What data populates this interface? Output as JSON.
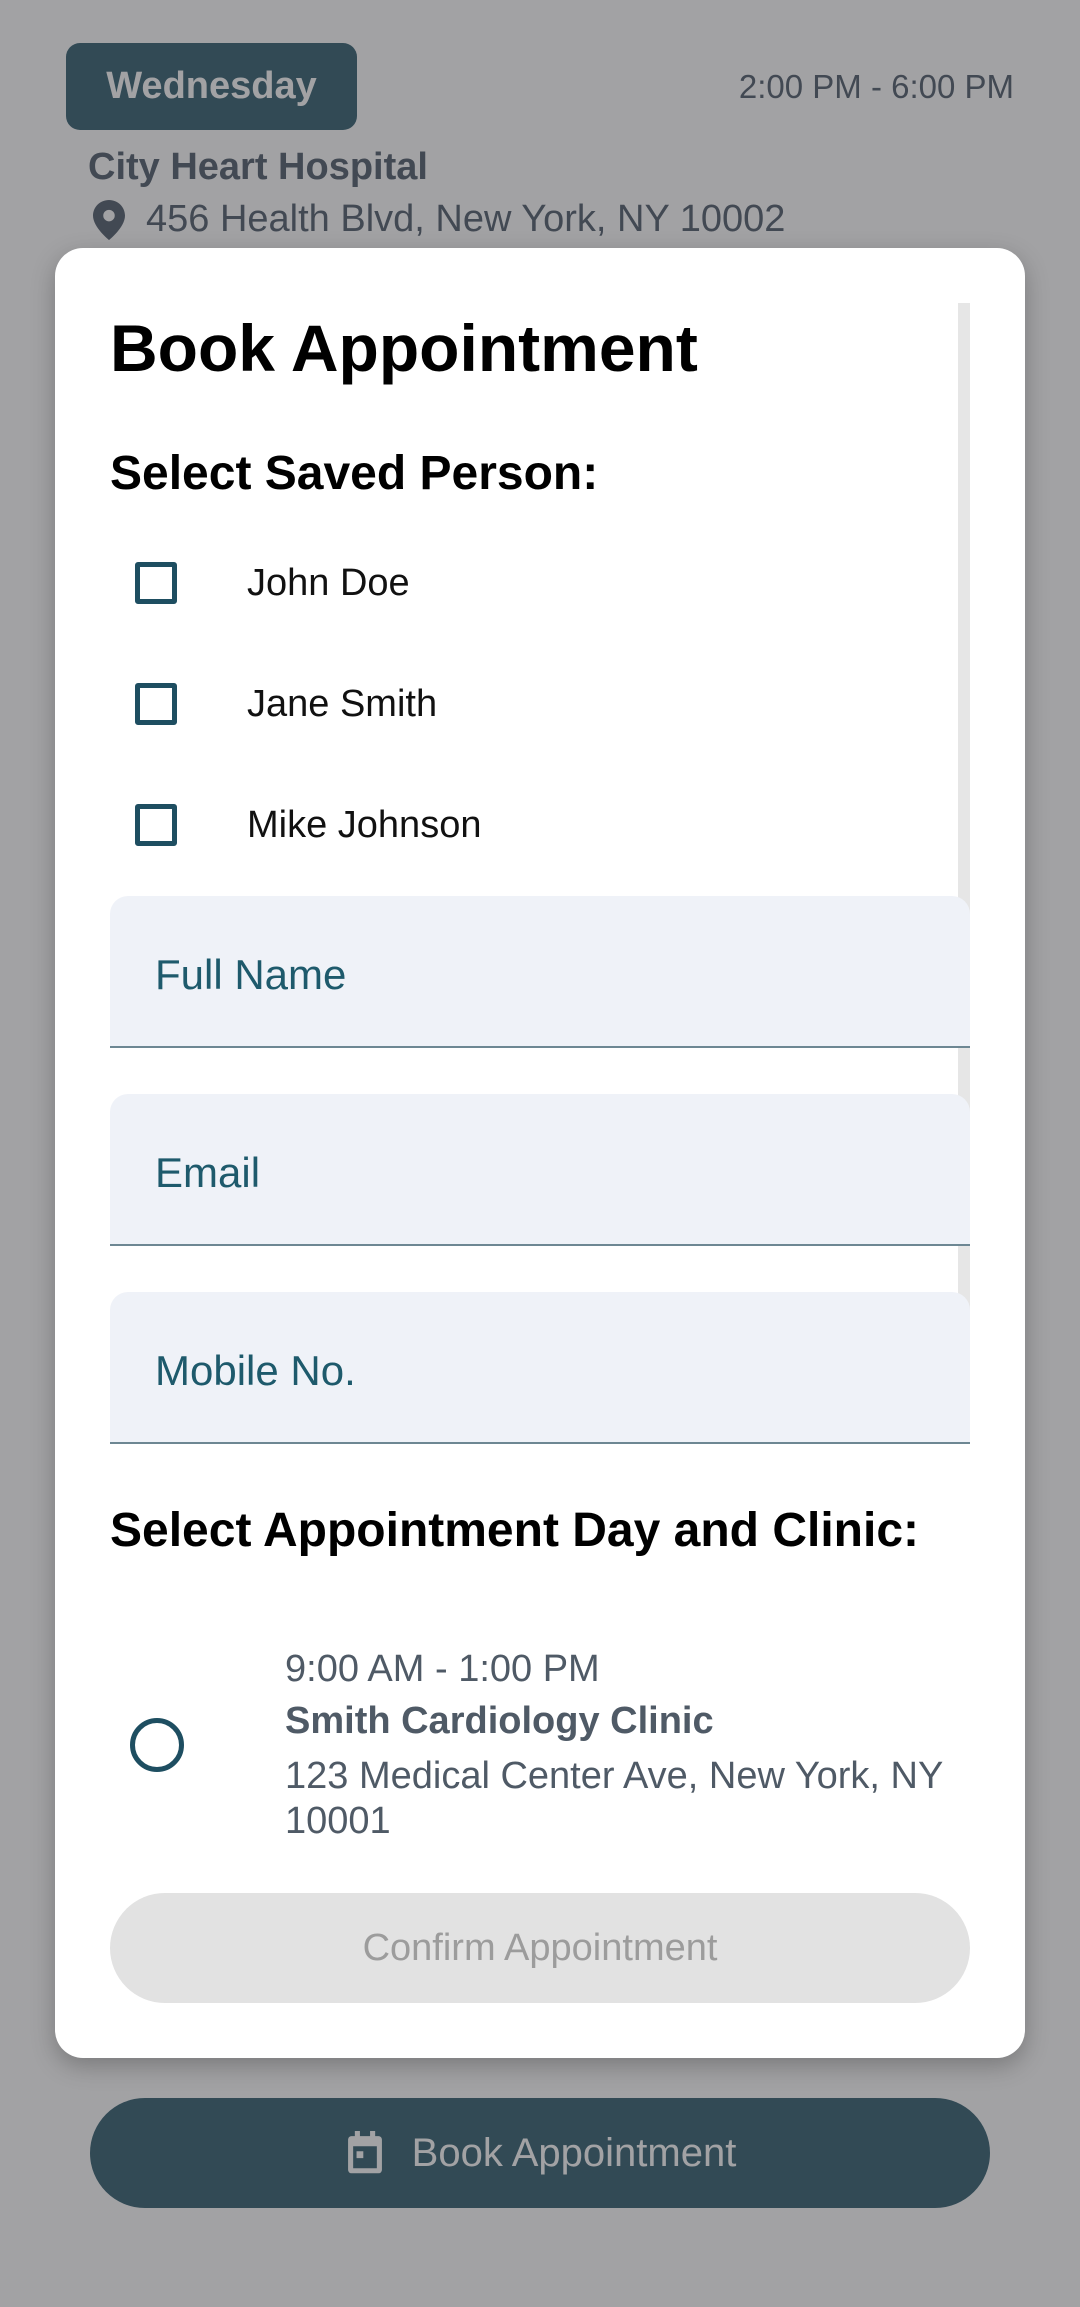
{
  "background": {
    "day_chip": "Wednesday",
    "time_range": "2:00 PM - 6:00 PM",
    "hospital_name": "City Heart Hospital",
    "hospital_address": "456 Health Blvd, New York, NY 10002",
    "book_button_label": "Book Appointment",
    "accent_color": "#1e4e61"
  },
  "dialog": {
    "title": "Book Appointment",
    "saved_person_label": "Select Saved Person:",
    "saved_persons": [
      {
        "name": "John Doe",
        "checked": false
      },
      {
        "name": "Jane Smith",
        "checked": false
      },
      {
        "name": "Mike Johnson",
        "checked": false
      }
    ],
    "fields": {
      "full_name": {
        "label": "Full Name",
        "value": ""
      },
      "email": {
        "label": "Email",
        "value": ""
      },
      "mobile": {
        "label": "Mobile No.",
        "value": ""
      }
    },
    "day_clinic_label": "Select Appointment Day and Clinic:",
    "slots": [
      {
        "time": "9:00 AM - 1:00 PM",
        "clinic": "Smith Cardiology Clinic",
        "address": "123 Medical Center Ave, New York, NY 10001",
        "selected": false
      }
    ],
    "confirm_label": "Confirm Appointment",
    "confirm_enabled": false
  }
}
